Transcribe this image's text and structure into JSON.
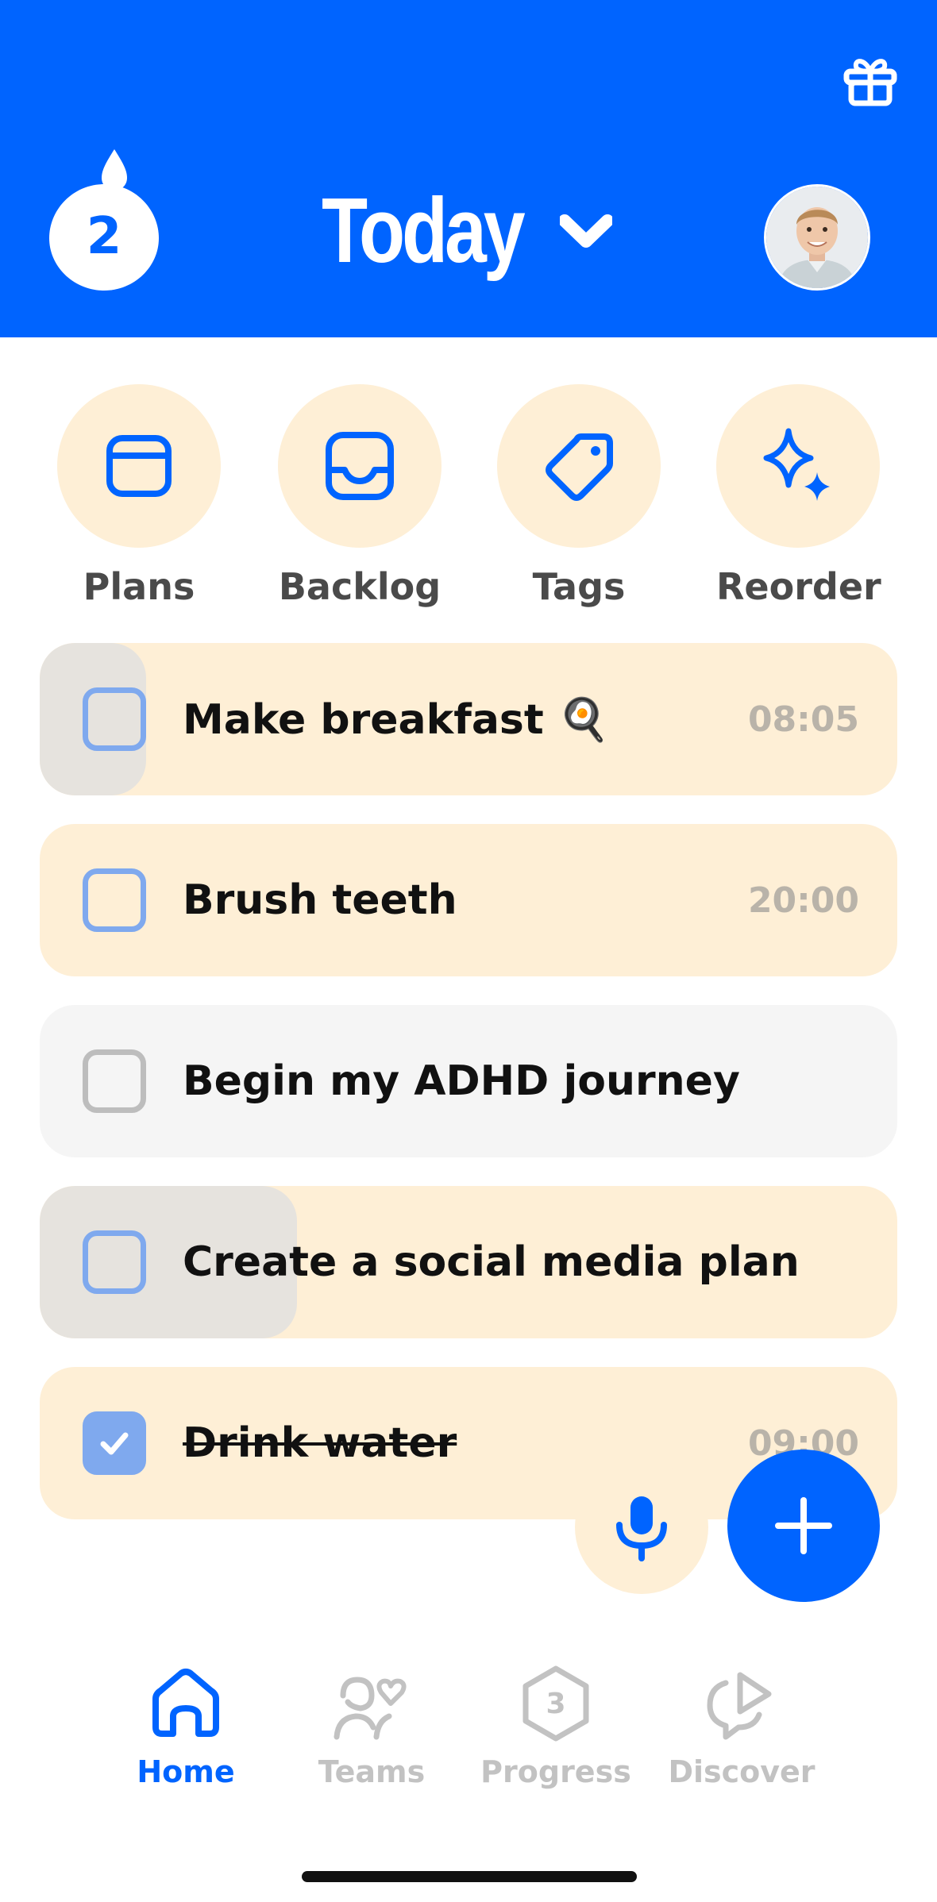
{
  "header": {
    "title": "Today",
    "streak_count": "2"
  },
  "quick_actions": [
    {
      "label": "Plans",
      "icon": "calendar-icon"
    },
    {
      "label": "Backlog",
      "icon": "inbox-icon"
    },
    {
      "label": "Tags",
      "icon": "tag-icon"
    },
    {
      "label": "Reorder",
      "icon": "sparkles-icon"
    }
  ],
  "tasks": [
    {
      "title": "Make breakfast 🍳",
      "time": "08:05",
      "done": false
    },
    {
      "title": "Brush teeth",
      "time": "20:00",
      "done": false
    },
    {
      "title": "Begin my ADHD journey",
      "time": "",
      "done": false
    },
    {
      "title": "Create a social media plan",
      "time": "",
      "done": false
    },
    {
      "title": "Drink water",
      "time": "09:00",
      "done": true
    }
  ],
  "tabs": [
    {
      "label": "Home",
      "icon": "home-icon",
      "active": true
    },
    {
      "label": "Teams",
      "icon": "teams-icon",
      "active": false
    },
    {
      "label": "Progress",
      "icon": "progress-icon",
      "badge": "3",
      "active": false
    },
    {
      "label": "Discover",
      "icon": "discover-icon",
      "active": false
    }
  ],
  "colors": {
    "brand_blue": "#0064FF",
    "cream": "#FEEFD6",
    "checkbox_blue": "#7FA9EE"
  }
}
